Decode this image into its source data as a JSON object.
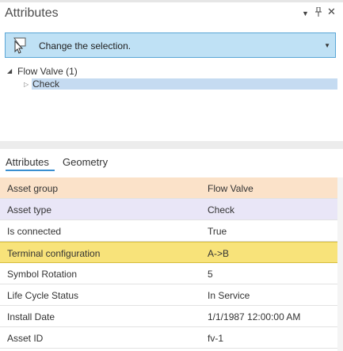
{
  "pane": {
    "title": "Attributes",
    "menu_glyph": "▼",
    "pin_glyph": "📌",
    "close_glyph": "✕"
  },
  "selection": {
    "prompt": "Change the selection.",
    "dropdown_glyph": "▼"
  },
  "tree": {
    "root": {
      "label": "Flow Valve (1)",
      "expanded": true
    },
    "child": {
      "label": "Check",
      "selected": true
    }
  },
  "tabs": [
    {
      "label": "Attributes",
      "active": true
    },
    {
      "label": "Geometry",
      "active": false
    }
  ],
  "attributes": [
    {
      "name": "Asset group",
      "value": "Flow Valve"
    },
    {
      "name": "Asset type",
      "value": "Check"
    },
    {
      "name": "Is connected",
      "value": "True"
    },
    {
      "name": "Terminal configuration",
      "value": "A->B"
    },
    {
      "name": "Symbol Rotation",
      "value": "5"
    },
    {
      "name": "Life Cycle Status",
      "value": "In Service"
    },
    {
      "name": "Install Date",
      "value": "1/1/1987 12:00:00 AM"
    },
    {
      "name": "Asset ID",
      "value": "fv-1"
    }
  ],
  "colors": {
    "selection_bar": "#bfe1f5",
    "asset_group_row": "#fbe2c9",
    "asset_type_row": "#e9e6f7",
    "terminal_row": "#f8e37a",
    "tab_underline": "#3a8fd0"
  }
}
